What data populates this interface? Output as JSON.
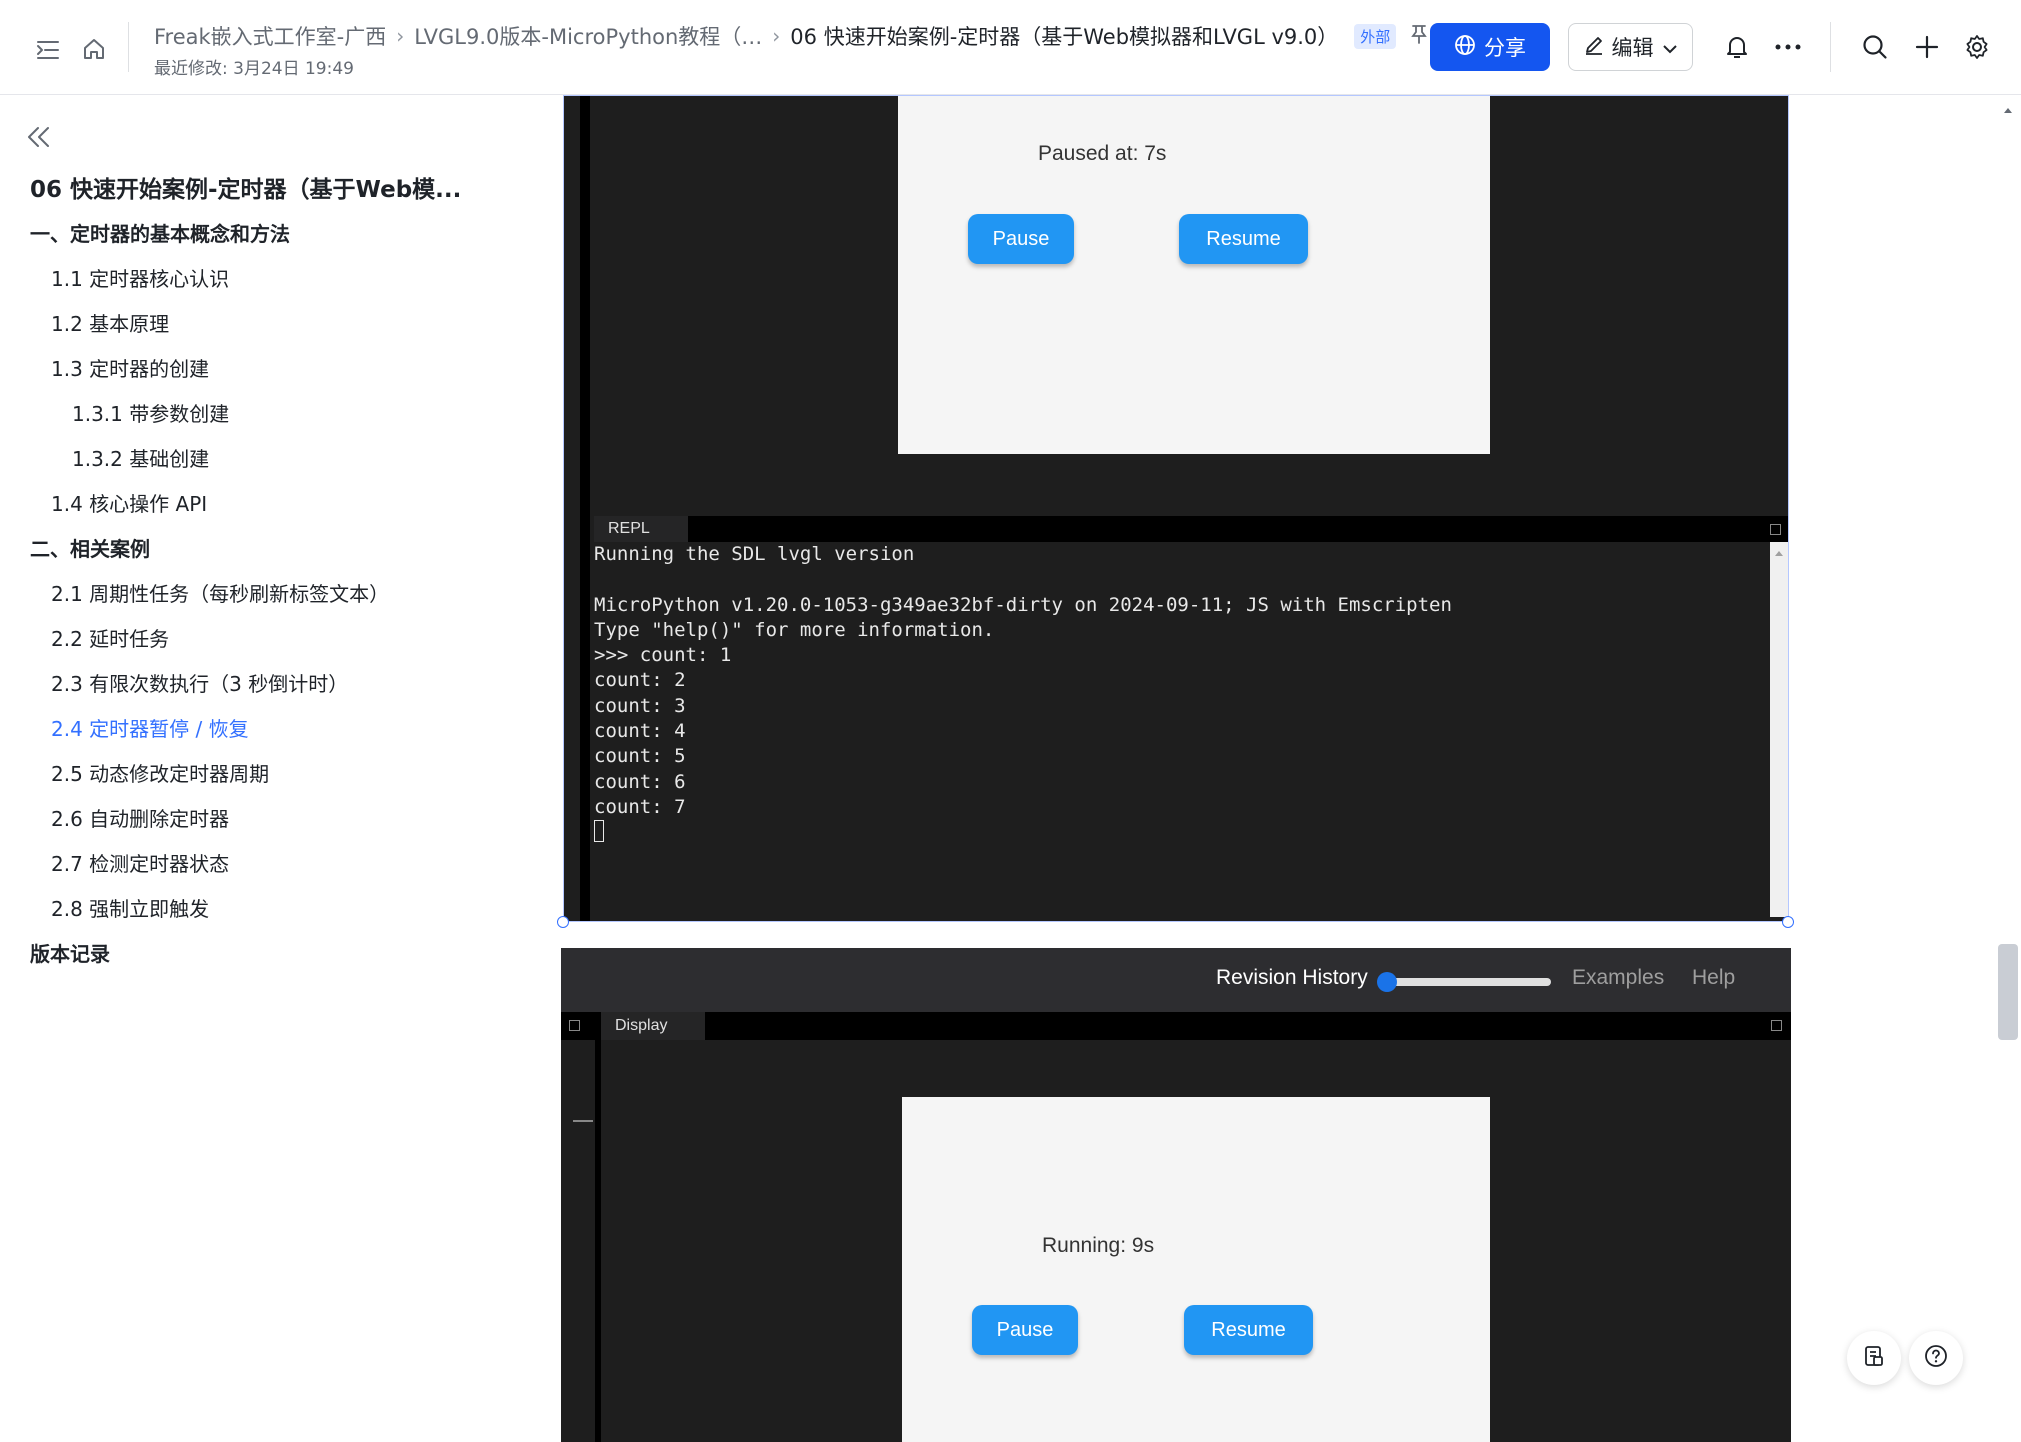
{
  "header": {
    "breadcrumbs": [
      "Freak嵌入式工作室-广西",
      "LVGL9.0版本-MicroPython教程（…",
      "06 快速开始案例-定时器（基于Web模拟器和LVGL v9.0）"
    ],
    "external_badge": "外部",
    "last_modified": "最近修改: 3月24日 19:49",
    "share_label": "分享",
    "edit_label": "编辑"
  },
  "toc": {
    "title": "06 快速开始案例-定时器（基于Web模...",
    "items": [
      {
        "label": "一、定时器的基本概念和方法"
      },
      {
        "label": "1.1 定时器核心认识"
      },
      {
        "label": "1.2 基本原理"
      },
      {
        "label": "1.3 定时器的创建"
      },
      {
        "label": "1.3.1 带参数创建"
      },
      {
        "label": "1.3.2 基础创建"
      },
      {
        "label": "1.4 核心操作 API"
      },
      {
        "label": "二、相关案例"
      },
      {
        "label": "2.1 周期性任务（每秒刷新标签文本）"
      },
      {
        "label": "2.2 延时任务"
      },
      {
        "label": "2.3 有限次数执行（3 秒倒计时）"
      },
      {
        "label": "2.4 定时器暂停 / 恢复"
      },
      {
        "label": "2.5 动态修改定时器周期"
      },
      {
        "label": "2.6 自动删除定时器"
      },
      {
        "label": "2.7 检测定时器状态"
      },
      {
        "label": "2.8 强制立即触发"
      },
      {
        "label": "版本记录"
      }
    ]
  },
  "sim1": {
    "status_label": "Paused at: 7s",
    "pause_label": "Pause",
    "resume_label": "Resume",
    "repl_tab": "REPL",
    "terminal_lines": [
      "Running the SDL lvgl version",
      "",
      "MicroPython v1.20.0-1053-g349ae32bf-dirty on 2024-09-11; JS with Emscripten",
      "Type \"help()\" for more information.",
      ">>> count: 1",
      "count: 2",
      "count: 3",
      "count: 4",
      "count: 5",
      "count: 6",
      "count: 7"
    ]
  },
  "sim2": {
    "menu": {
      "revision_history": "Revision History",
      "examples": "Examples",
      "help": "Help"
    },
    "revision_slider_value": 0,
    "display_tab": "Display",
    "status_label": "Running: 9s",
    "pause_label": "Pause",
    "resume_label": "Resume"
  },
  "colors": {
    "accent": "#3370ff",
    "share_button": "#1456f0",
    "lvgl_button": "#2196f3"
  }
}
